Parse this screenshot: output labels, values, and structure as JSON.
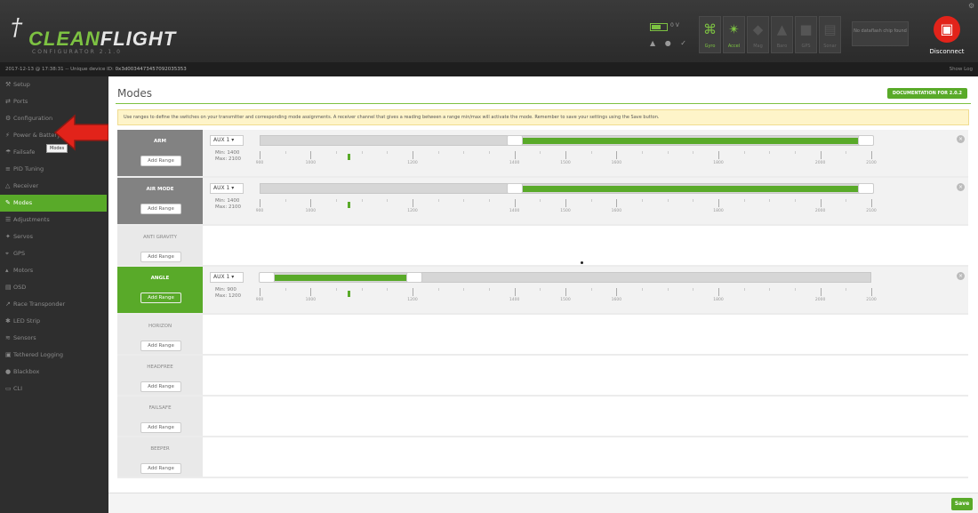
{
  "header": {
    "logo_mark": "†",
    "logo_text_a": "CLEAN",
    "logo_text_b": "FLIGHT",
    "logo_sub": "CONFIGURATOR 2.1.0",
    "battery_voltage": "0 V",
    "battery_level": 0.55,
    "status_icons": "▲ ● ✓",
    "sensors": [
      {
        "label": "Gyro",
        "icon": "gyro-icon",
        "glyph": "⌘",
        "on": true
      },
      {
        "label": "Accel",
        "icon": "accel-icon",
        "glyph": "✴",
        "on": true
      },
      {
        "label": "Mag",
        "icon": "mag-icon",
        "glyph": "◆",
        "on": false
      },
      {
        "label": "Baro",
        "icon": "baro-icon",
        "glyph": "▲",
        "on": false
      },
      {
        "label": "GPS",
        "icon": "gps-icon",
        "glyph": "■",
        "on": false
      },
      {
        "label": "Sonar",
        "icon": "sonar-icon",
        "glyph": "▤",
        "on": false
      }
    ],
    "dataflash": "No dataflash chip found",
    "disconnect_label": "Disconnect",
    "disconnect_glyph": "▣"
  },
  "infobar": {
    "text": "2017-12-13 @ 17:38:31 -- Unique device ID: ",
    "device_id": "0x3d0034473457092035353",
    "show_log": "Show Log"
  },
  "sidebar": {
    "items": [
      {
        "label": "Setup",
        "glyph": "⚒"
      },
      {
        "label": "Ports",
        "glyph": "⇄"
      },
      {
        "label": "Configuration",
        "glyph": "⚙"
      },
      {
        "label": "Power & Battery",
        "glyph": "⚡"
      },
      {
        "label": "Failsafe",
        "glyph": "☂"
      },
      {
        "label": "PID Tuning",
        "glyph": "≡"
      },
      {
        "label": "Receiver",
        "glyph": "△"
      },
      {
        "label": "Modes",
        "glyph": "✎"
      },
      {
        "label": "Adjustments",
        "glyph": "☰"
      },
      {
        "label": "Servos",
        "glyph": "✦"
      },
      {
        "label": "GPS",
        "glyph": "⌖"
      },
      {
        "label": "Motors",
        "glyph": "▴"
      },
      {
        "label": "OSD",
        "glyph": "▤"
      },
      {
        "label": "Race Transponder",
        "glyph": "↗"
      },
      {
        "label": "LED Strip",
        "glyph": "✱"
      },
      {
        "label": "Sensors",
        "glyph": "≋"
      },
      {
        "label": "Tethered Logging",
        "glyph": "▣"
      },
      {
        "label": "Blackbox",
        "glyph": "●"
      },
      {
        "label": "CLI",
        "glyph": "▭"
      }
    ],
    "active_index": 7,
    "tooltip": "Modes"
  },
  "main": {
    "title": "Modes",
    "docs_button": "DOCUMENTATION FOR 2.0.2",
    "note": "Use ranges to define the switches on your transmitter and corresponding mode assignments. A receiver channel that gives a reading between a range min/max will activate the mode. Remember to save your settings using the Save button.",
    "add_range_label": "Add Range",
    "save_label": "Save",
    "scale_labels": [
      "900",
      "1000",
      "1200",
      "1400",
      "1500",
      "1600",
      "1800",
      "2000",
      "2100"
    ],
    "modes": [
      {
        "name": "ARM",
        "state": "armed",
        "range": {
          "channel": "AUX 1 ▾",
          "min": "Min: 1400",
          "max": "Max: 2100",
          "min_value": 1400,
          "max_value": 2100,
          "live_value": 1075
        }
      },
      {
        "name": "AIR MODE",
        "state": "armed",
        "range": {
          "channel": "AUX 1 ▾",
          "min": "Min: 1400",
          "max": "Max: 2100",
          "min_value": 1400,
          "max_value": 2100,
          "live_value": 1075
        }
      },
      {
        "name": "ANTI GRAVITY",
        "state": "none",
        "range": null
      },
      {
        "name": "ANGLE",
        "state": "active",
        "range": {
          "channel": "AUX 1 ▾",
          "min": "Min: 900",
          "max": "Max: 1200",
          "min_value": 900,
          "max_value": 1200,
          "live_value": 1075
        }
      },
      {
        "name": "HORIZON",
        "state": "none",
        "range": null
      },
      {
        "name": "HEADFREE",
        "state": "none",
        "range": null
      },
      {
        "name": "FAILSAFE",
        "state": "none",
        "range": null
      },
      {
        "name": "BEEPER",
        "state": "none",
        "range": null
      }
    ]
  },
  "colors": {
    "accent": "#59aa29",
    "disconnect": "#e2231a",
    "arrow": "#e2231a"
  }
}
